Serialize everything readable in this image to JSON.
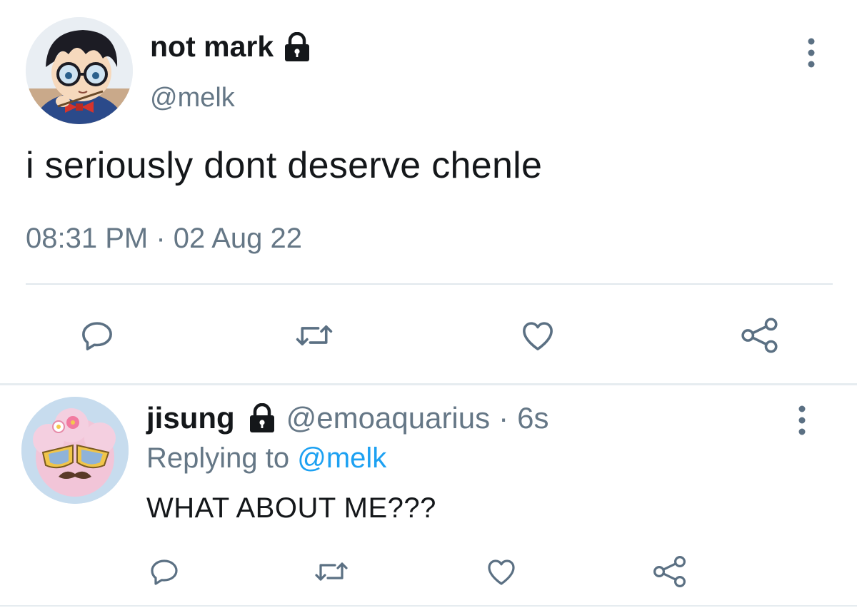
{
  "main_tweet": {
    "display_name": "not mark",
    "handle": "@melk",
    "text": "i seriously dont deserve chenle",
    "time": "08:31 PM",
    "separator": "·",
    "date": "02 Aug 22"
  },
  "reply_tweet": {
    "display_name": "jisung",
    "handle": "@emoaquarius",
    "separator": "·",
    "time": "6s",
    "replying_prefix": "Replying to",
    "replying_to": "@melk",
    "text": "WHAT ABOUT ME???"
  },
  "icons": {
    "lock": "lock-icon",
    "menu": "more-vertical-icon",
    "reply": "reply-icon",
    "retweet": "retweet-icon",
    "like": "heart-icon",
    "share": "share-icon"
  },
  "colors": {
    "text": "#14171a",
    "secondary": "#657786",
    "icon": "#5b7083",
    "link": "#1da1f2",
    "divider": "#e1e8ed"
  }
}
